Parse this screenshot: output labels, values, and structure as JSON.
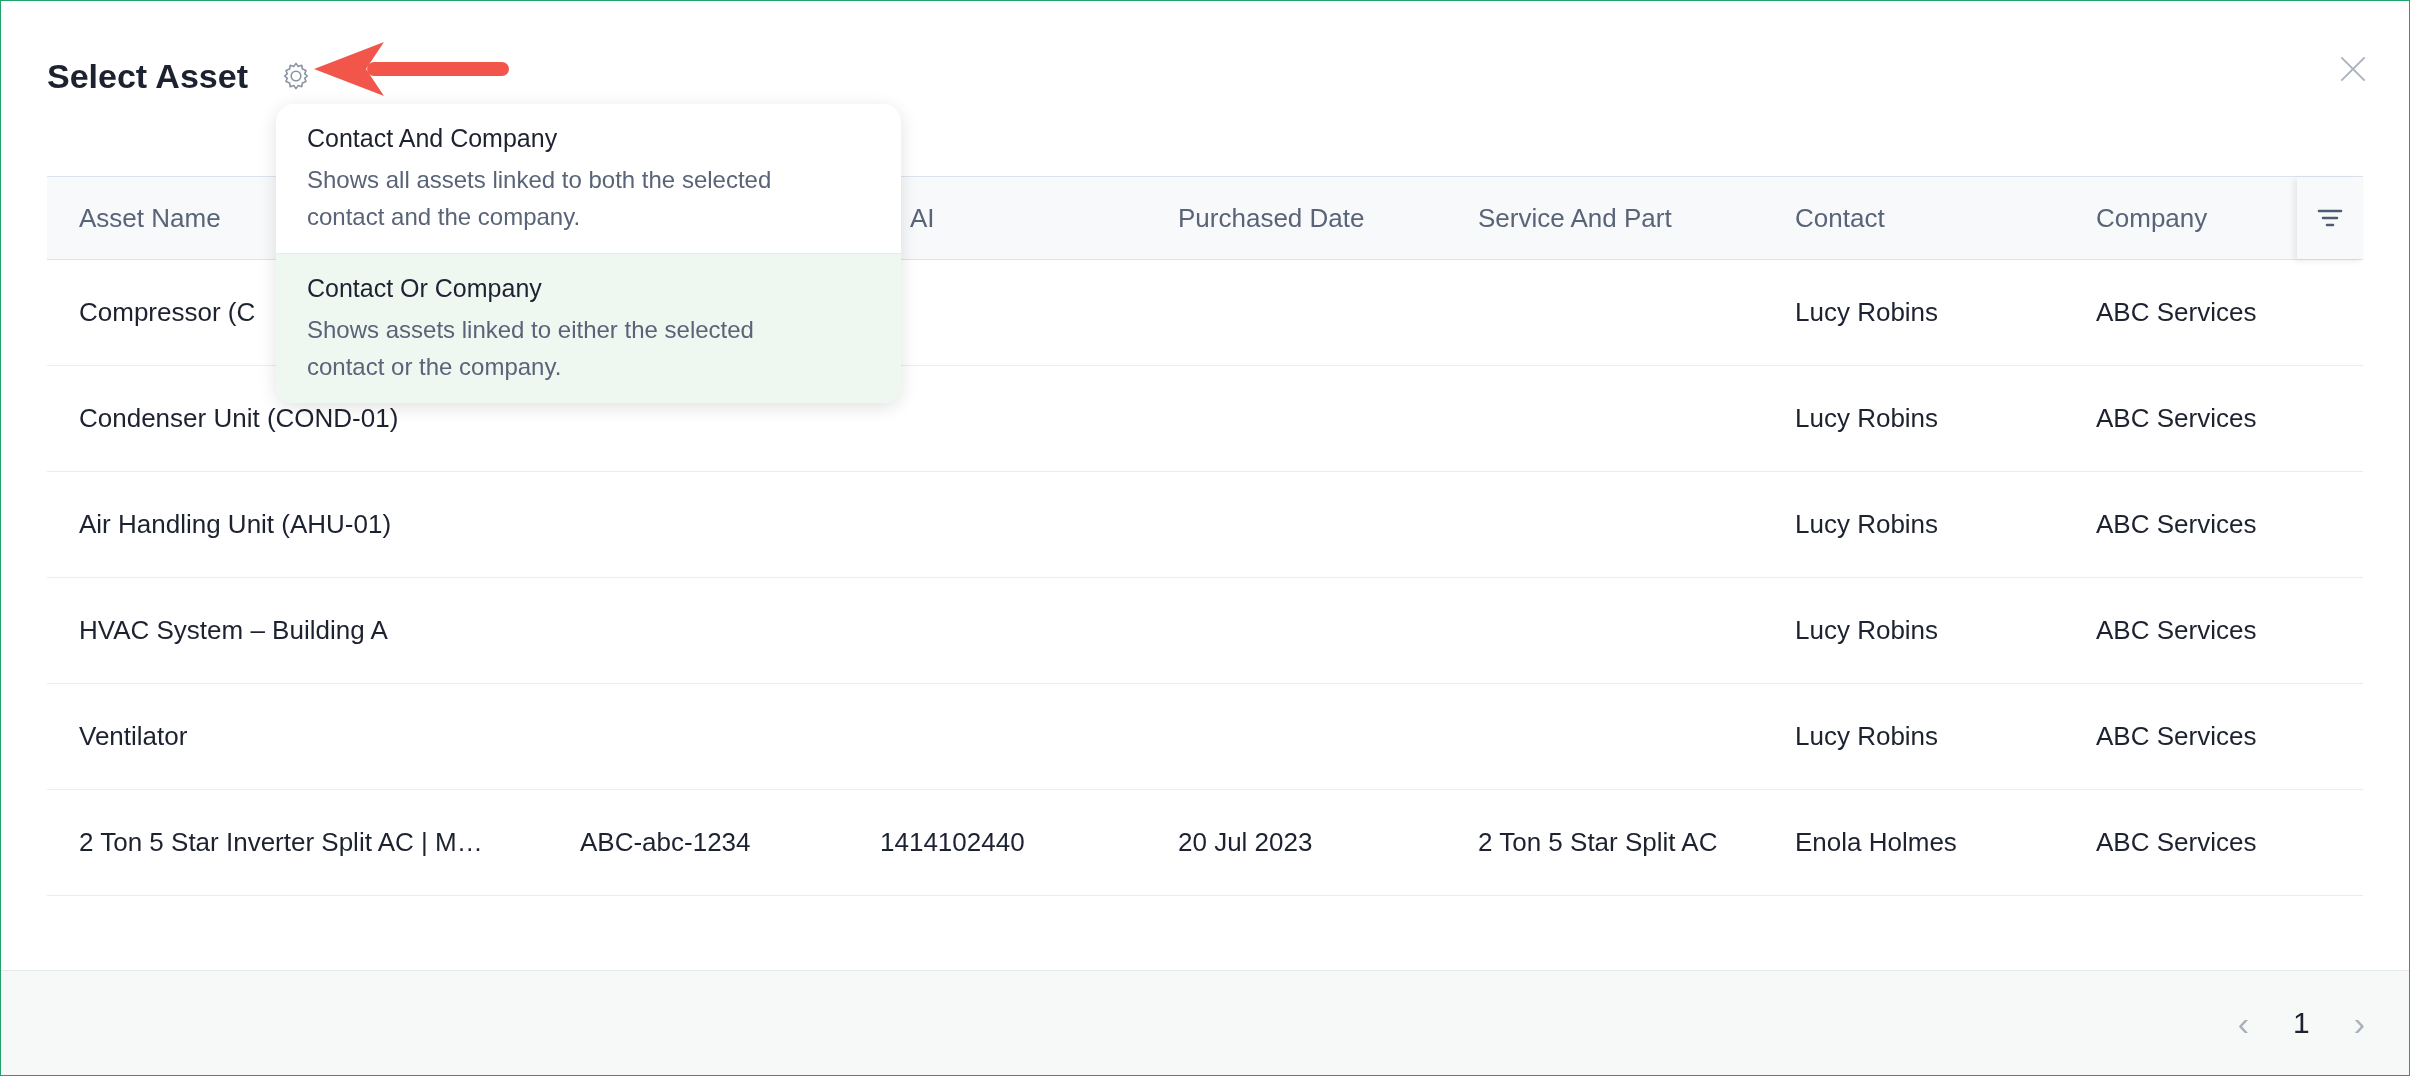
{
  "dialog": {
    "title": "Select Asset"
  },
  "menu": {
    "options": [
      {
        "title": "Contact And Company",
        "description": "Shows all assets linked to both the selected contact and the company.",
        "selected": false
      },
      {
        "title": "Contact Or Company",
        "description": "Shows assets linked to either the selected contact or the company.",
        "selected": true
      }
    ]
  },
  "table": {
    "columns": [
      "Asset Name",
      null,
      "AI",
      "Purchased Date",
      "Service And Part",
      "Contact",
      "Company"
    ],
    "rows": [
      [
        "Compressor (C",
        null,
        null,
        null,
        null,
        "Lucy Robins",
        "ABC Services"
      ],
      [
        "Condenser Unit (COND-01)",
        null,
        null,
        null,
        null,
        "Lucy Robins",
        "ABC Services"
      ],
      [
        "Air Handling Unit (AHU-01)",
        null,
        null,
        null,
        null,
        "Lucy Robins",
        "ABC Services"
      ],
      [
        "HVAC System – Building A",
        null,
        null,
        null,
        null,
        "Lucy Robins",
        "ABC Services"
      ],
      [
        "Ventilator",
        null,
        null,
        null,
        null,
        "Lucy Robins",
        "ABC Services"
      ],
      [
        "2 Ton 5 Star Inverter Split AC | M…",
        "ABC-abc-1234",
        "1414102440",
        "20 Jul 2023",
        "2 Ton 5 Star Split AC",
        "Enola Holmes",
        "ABC Services"
      ]
    ]
  },
  "pagination": {
    "prev": "‹",
    "page": "1",
    "next": "›"
  }
}
